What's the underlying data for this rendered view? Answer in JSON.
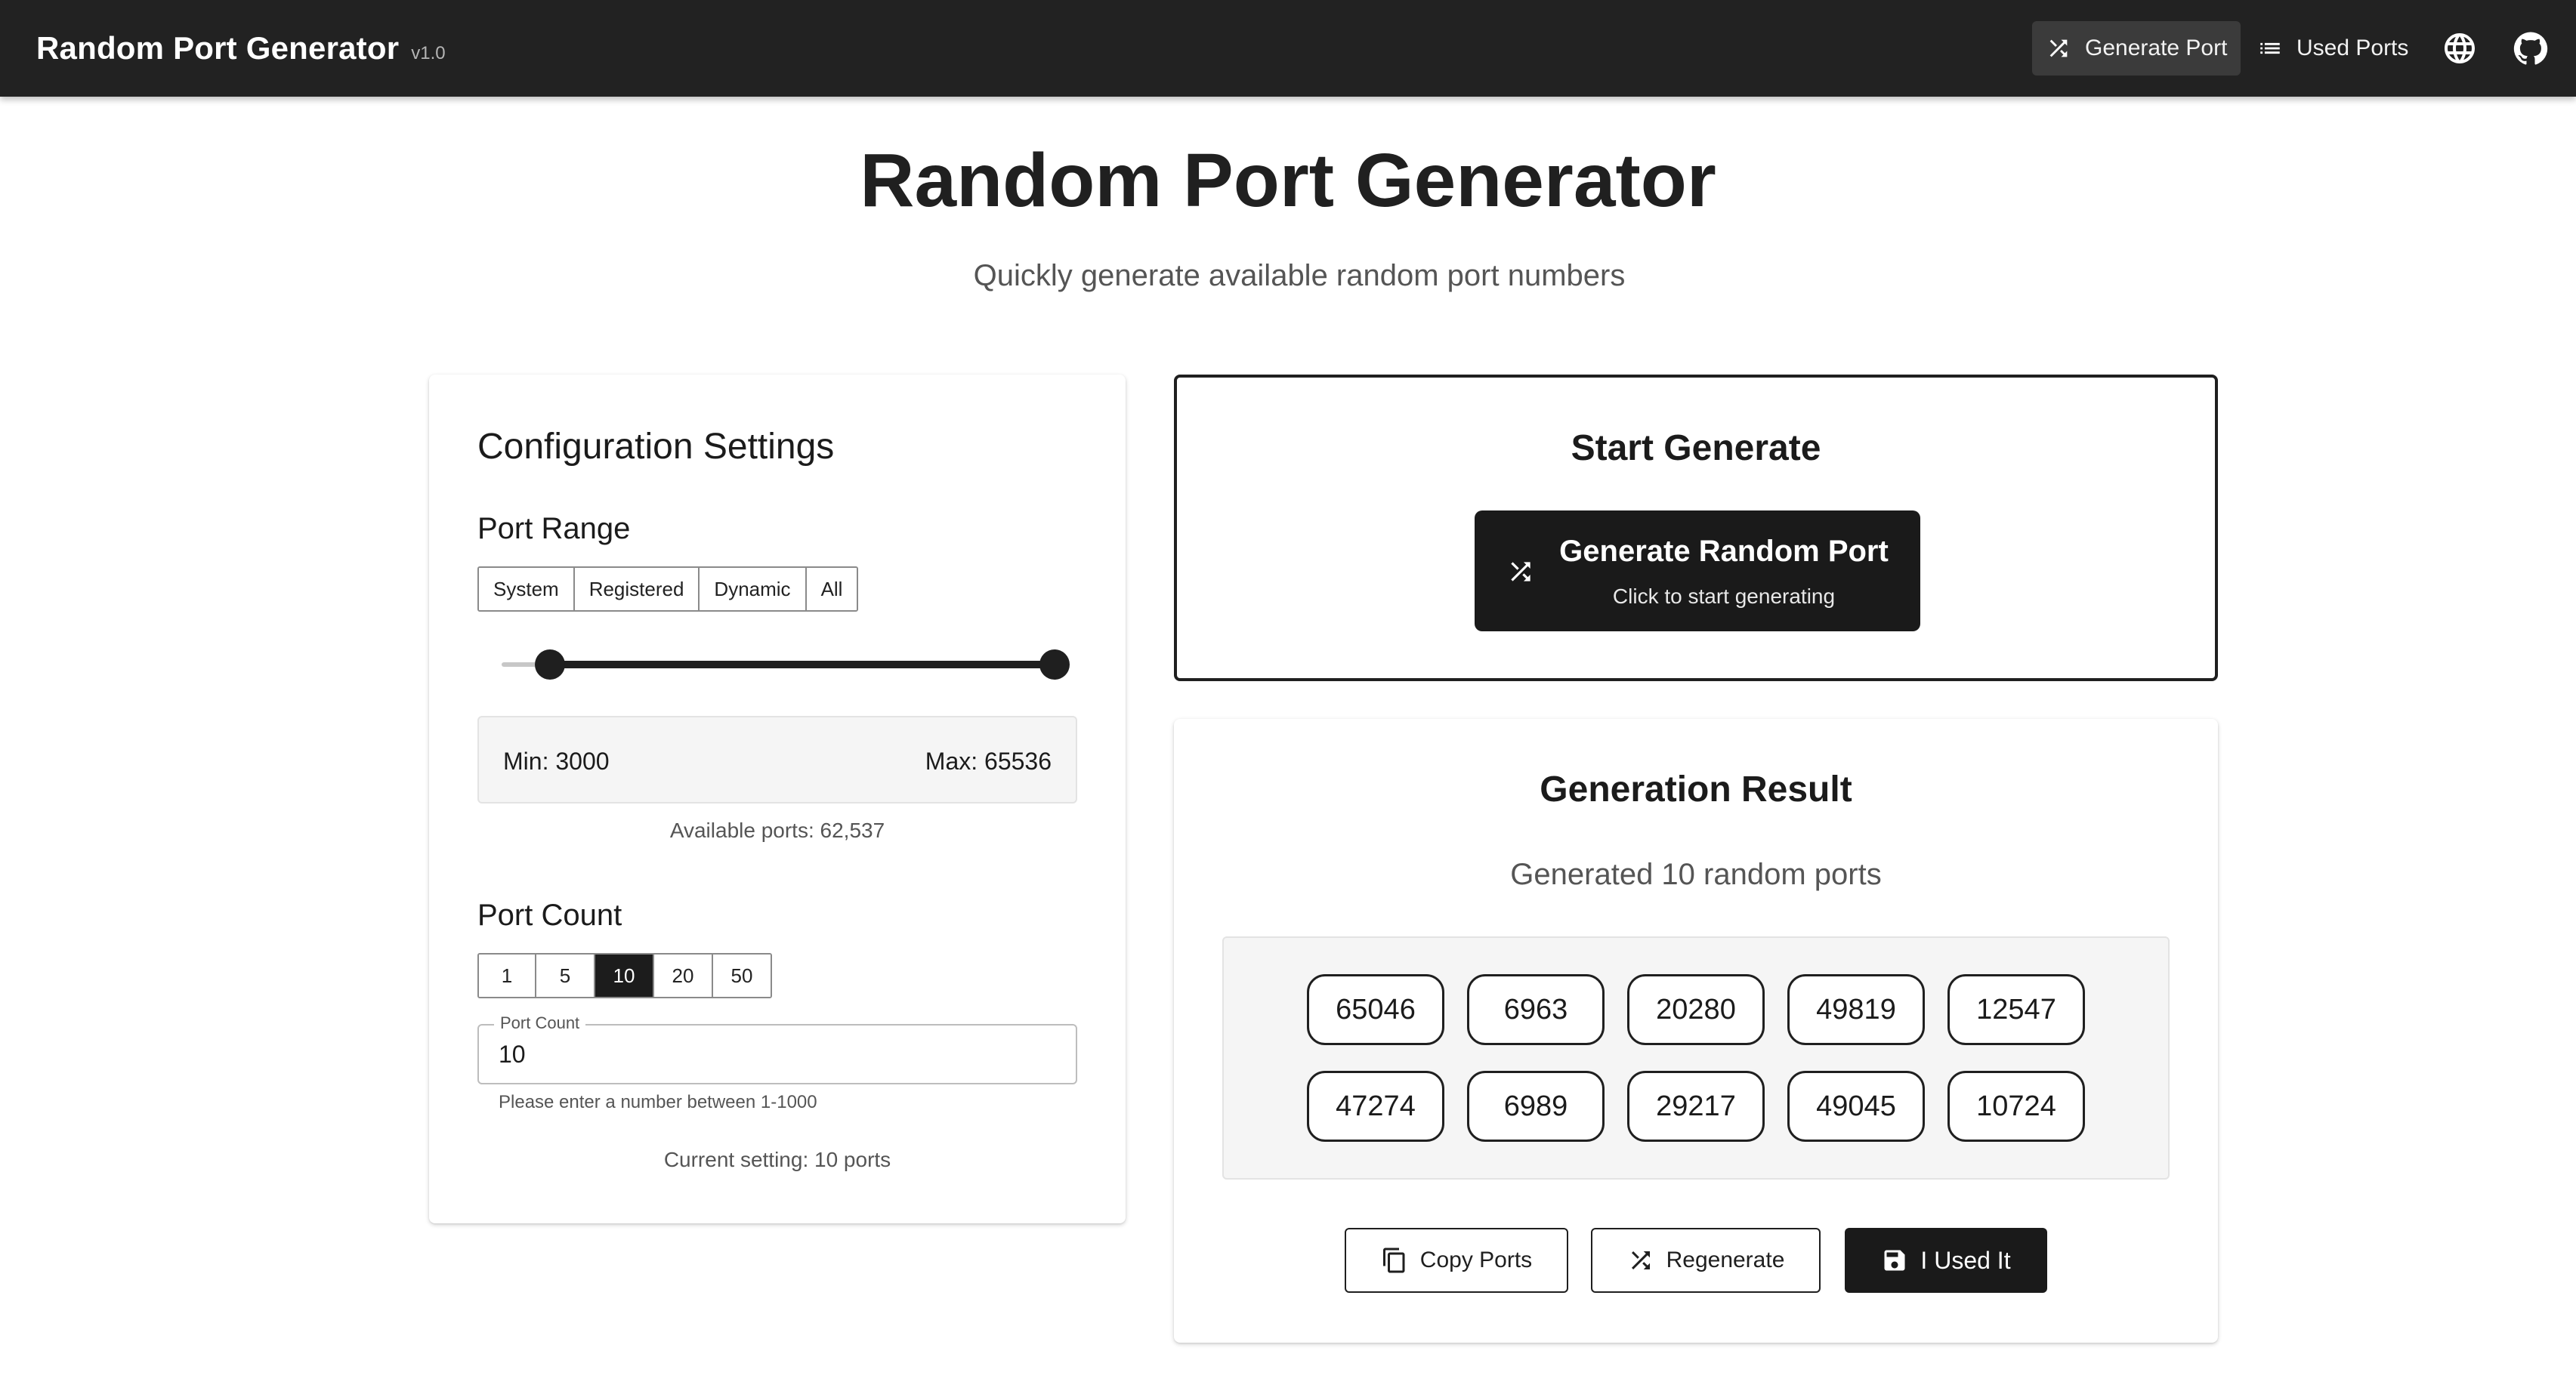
{
  "appbar": {
    "title": "Random Port Generator",
    "version": "v1.0",
    "nav_generate": "Generate Port",
    "nav_used": "Used Ports",
    "icons": [
      "shuffle-icon",
      "list-icon",
      "globe-icon",
      "github-icon"
    ]
  },
  "header": {
    "title": "Random Port Generator",
    "subtitle": "Quickly generate available random port numbers"
  },
  "config": {
    "title": "Configuration Settings",
    "range_title": "Port Range",
    "range_presets": [
      "System",
      "Registered",
      "Dynamic",
      "All"
    ],
    "slider": {
      "min": 3000,
      "max": 65536,
      "scale_min": 0,
      "scale_max": 65536
    },
    "min_label": "Min: 3000",
    "max_label": "Max: 65536",
    "available": "Available ports: 62,537",
    "count_title": "Port Count",
    "count_presets": [
      "1",
      "5",
      "10",
      "20",
      "50"
    ],
    "count_selected": "10",
    "field_label": "Port Count",
    "field_value": "10",
    "helper": "Please enter a number between 1-1000",
    "current": "Current setting: 10 ports"
  },
  "start": {
    "title": "Start Generate",
    "button_label": "Generate Random Port",
    "button_sub": "Click to start generating"
  },
  "result": {
    "title": "Generation Result",
    "summary": "Generated 10 random ports",
    "ports": [
      "65046",
      "6963",
      "20280",
      "49819",
      "12547",
      "47274",
      "6989",
      "29217",
      "49045",
      "10724"
    ],
    "copy_label": "Copy Ports",
    "regen_label": "Regenerate",
    "used_label": "I Used It"
  },
  "colors": {
    "appbar": "#222222",
    "accent": "#1a1a1a",
    "panel": "#f5f5f5"
  }
}
